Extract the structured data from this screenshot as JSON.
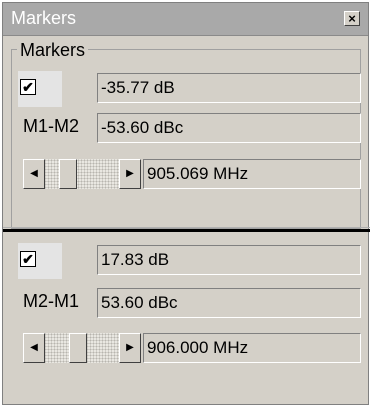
{
  "window": {
    "title": "Markers",
    "close_label": "×"
  },
  "group": {
    "label": "Markers"
  },
  "marker1": {
    "checked": "✔",
    "level": "-35.77 dB",
    "delta_label": "M1-M2",
    "delta_value": "-53.60 dBc",
    "frequency": "905.069 MHz",
    "slider_position_fraction": 0.25
  },
  "marker2": {
    "checked": "✔",
    "level": "17.83 dB",
    "delta_label": "M2-M1",
    "delta_value": "53.60 dBc",
    "frequency": "906.000 MHz",
    "slider_position_fraction": 0.42
  },
  "icons": {
    "scroll_left": "◀",
    "scroll_right": "▶"
  }
}
